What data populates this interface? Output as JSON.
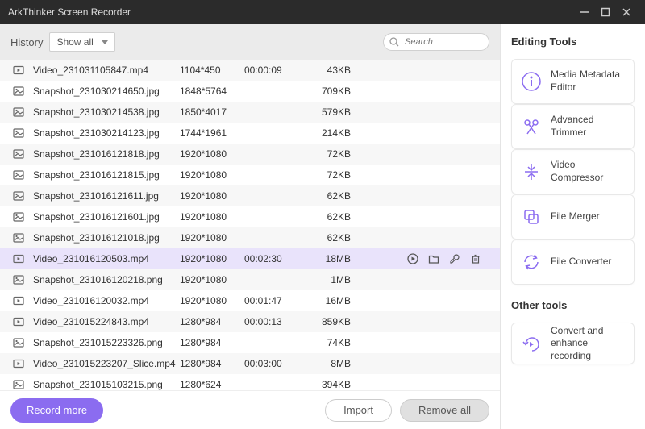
{
  "app": {
    "title": "ArkThinker Screen Recorder"
  },
  "toolbar": {
    "history_label": "History",
    "filter_label": "Show all",
    "search_placeholder": "Search"
  },
  "files": [
    {
      "icon": "video",
      "name": "Video_231031105847.mp4",
      "res": "1104*450",
      "dur": "00:00:09",
      "size": "43KB"
    },
    {
      "icon": "image",
      "name": "Snapshot_231030214650.jpg",
      "res": "1848*5764",
      "dur": "",
      "size": "709KB"
    },
    {
      "icon": "image",
      "name": "Snapshot_231030214538.jpg",
      "res": "1850*4017",
      "dur": "",
      "size": "579KB"
    },
    {
      "icon": "image",
      "name": "Snapshot_231030214123.jpg",
      "res": "1744*1961",
      "dur": "",
      "size": "214KB"
    },
    {
      "icon": "image",
      "name": "Snapshot_231016121818.jpg",
      "res": "1920*1080",
      "dur": "",
      "size": "72KB"
    },
    {
      "icon": "image",
      "name": "Snapshot_231016121815.jpg",
      "res": "1920*1080",
      "dur": "",
      "size": "72KB"
    },
    {
      "icon": "image",
      "name": "Snapshot_231016121611.jpg",
      "res": "1920*1080",
      "dur": "",
      "size": "62KB"
    },
    {
      "icon": "image",
      "name": "Snapshot_231016121601.jpg",
      "res": "1920*1080",
      "dur": "",
      "size": "62KB"
    },
    {
      "icon": "image",
      "name": "Snapshot_231016121018.jpg",
      "res": "1920*1080",
      "dur": "",
      "size": "62KB"
    },
    {
      "icon": "video",
      "name": "Video_231016120503.mp4",
      "res": "1920*1080",
      "dur": "00:02:30",
      "size": "18MB",
      "selected": true
    },
    {
      "icon": "image",
      "name": "Snapshot_231016120218.png",
      "res": "1920*1080",
      "dur": "",
      "size": "1MB"
    },
    {
      "icon": "video",
      "name": "Video_231016120032.mp4",
      "res": "1920*1080",
      "dur": "00:01:47",
      "size": "16MB"
    },
    {
      "icon": "video",
      "name": "Video_231015224843.mp4",
      "res": "1280*984",
      "dur": "00:00:13",
      "size": "859KB"
    },
    {
      "icon": "image",
      "name": "Snapshot_231015223326.png",
      "res": "1280*984",
      "dur": "",
      "size": "74KB"
    },
    {
      "icon": "video",
      "name": "Video_231015223207_Slice.mp4",
      "res": "1280*984",
      "dur": "00:03:00",
      "size": "8MB"
    },
    {
      "icon": "image",
      "name": "Snapshot_231015103215.png",
      "res": "1280*624",
      "dur": "",
      "size": "394KB"
    }
  ],
  "buttons": {
    "record_more": "Record more",
    "import": "Import",
    "remove_all": "Remove all"
  },
  "right": {
    "editing_title": "Editing Tools",
    "other_title": "Other tools",
    "tools": [
      {
        "label": "Media Metadata Editor",
        "icon": "info"
      },
      {
        "label": "Advanced Trimmer",
        "icon": "scissors"
      },
      {
        "label": "Video Compressor",
        "icon": "compress"
      },
      {
        "label": "File Merger",
        "icon": "merge"
      },
      {
        "label": "File Converter",
        "icon": "convert"
      }
    ],
    "other_tools": [
      {
        "label": "Convert and enhance recording",
        "icon": "enhance"
      }
    ]
  }
}
